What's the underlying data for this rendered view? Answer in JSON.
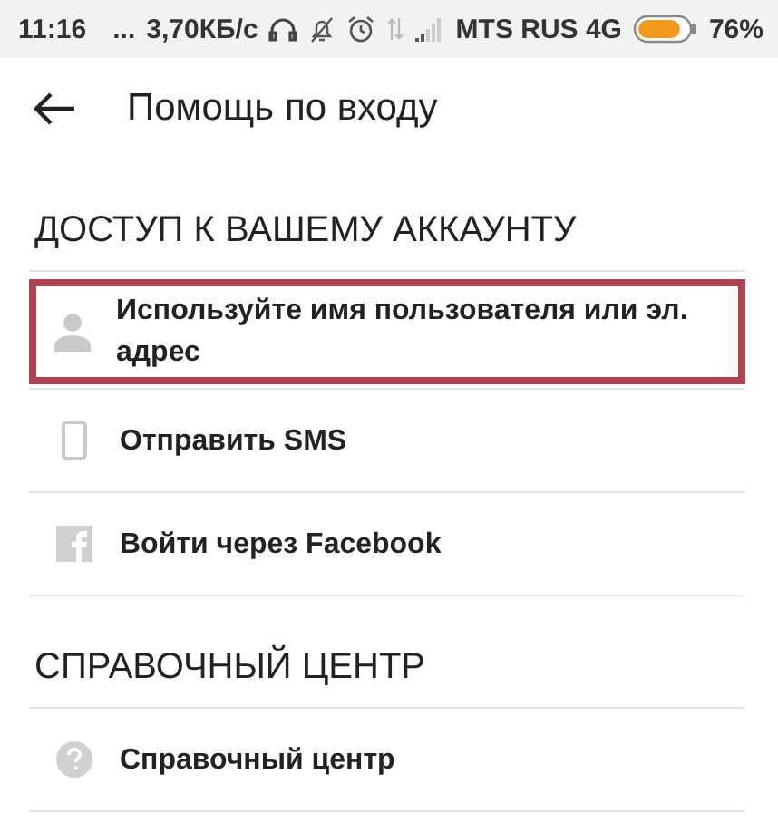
{
  "status_bar": {
    "time": "11:16",
    "more": "...",
    "speed": "3,70КБ/с",
    "carrier": "MTS RUS 4G",
    "battery": "76%"
  },
  "header": {
    "title": "Помощь по входу"
  },
  "sections": [
    {
      "title": "ДОСТУП К ВАШЕМУ АККАУНТУ",
      "items": [
        {
          "kind": "user",
          "label": "Используйте имя пользователя или эл. адрес",
          "highlighted": true
        },
        {
          "kind": "phone",
          "label": "Отправить SMS",
          "highlighted": false
        },
        {
          "kind": "facebook",
          "label": "Войти через Facebook",
          "highlighted": false
        }
      ]
    },
    {
      "title": "СПРАВОЧНЫЙ ЦЕНТР",
      "items": [
        {
          "kind": "help",
          "label": "Справочный центр",
          "highlighted": false
        }
      ]
    }
  ]
}
